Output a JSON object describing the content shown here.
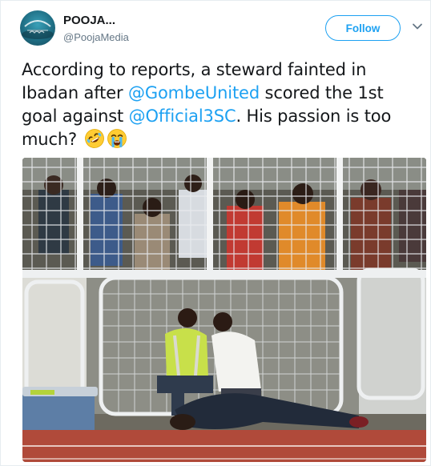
{
  "tweet": {
    "display_name": "POOJA...",
    "handle": "@PoojaMedia",
    "follow_label": "Follow",
    "text_parts": {
      "p1": "According to reports, a steward fainted in Ibadan after ",
      "mention1": "@GombeUnited",
      "p2": " scored the 1st goal against ",
      "mention2": "@Official3SC",
      "p3": ". His passion is too much? "
    },
    "emojis": [
      "rolling-on-floor-laughing",
      "loudly-crying-face"
    ]
  },
  "colors": {
    "accent": "#1da1f2",
    "text": "#14171a",
    "secondary": "#657786"
  },
  "icons": {
    "avatar": "profile-avatar",
    "menu": "chevron-down-icon"
  }
}
